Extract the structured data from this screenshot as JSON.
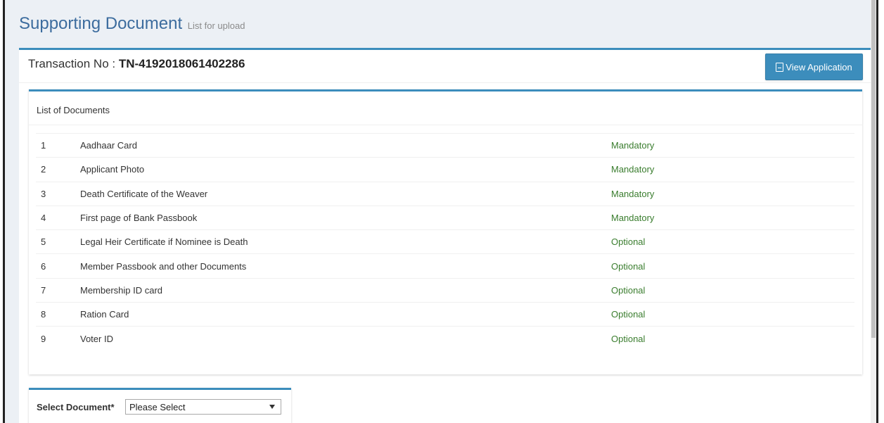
{
  "header": {
    "title": "Supporting Document",
    "subtitle": "List for upload"
  },
  "transaction": {
    "label": "Transaction No :",
    "value": "TN-4192018061402286"
  },
  "view_button": {
    "label": "View Application",
    "icon": "file-pdf-icon"
  },
  "documents": {
    "header": "List of Documents",
    "items": [
      {
        "num": "1",
        "name": "Aadhaar Card",
        "status": "Mandatory"
      },
      {
        "num": "2",
        "name": "Applicant Photo",
        "status": "Mandatory"
      },
      {
        "num": "3",
        "name": "Death Certificate of the Weaver",
        "status": "Mandatory"
      },
      {
        "num": "4",
        "name": "First page of Bank Passbook",
        "status": "Mandatory"
      },
      {
        "num": "5",
        "name": "Legal Heir Certificate if Nominee is Death",
        "status": "Optional"
      },
      {
        "num": "6",
        "name": "Member Passbook and other Documents",
        "status": "Optional"
      },
      {
        "num": "7",
        "name": "Membership ID card",
        "status": "Optional"
      },
      {
        "num": "8",
        "name": "Ration Card",
        "status": "Optional"
      },
      {
        "num": "9",
        "name": "Voter ID",
        "status": "Optional"
      }
    ]
  },
  "select_document": {
    "label": "Select Document*",
    "selected": "Please Select"
  },
  "colors": {
    "accent": "#3c8dbc",
    "title": "#3c6c9e",
    "status": "#3a7d2e",
    "background": "#ecf0f5"
  }
}
